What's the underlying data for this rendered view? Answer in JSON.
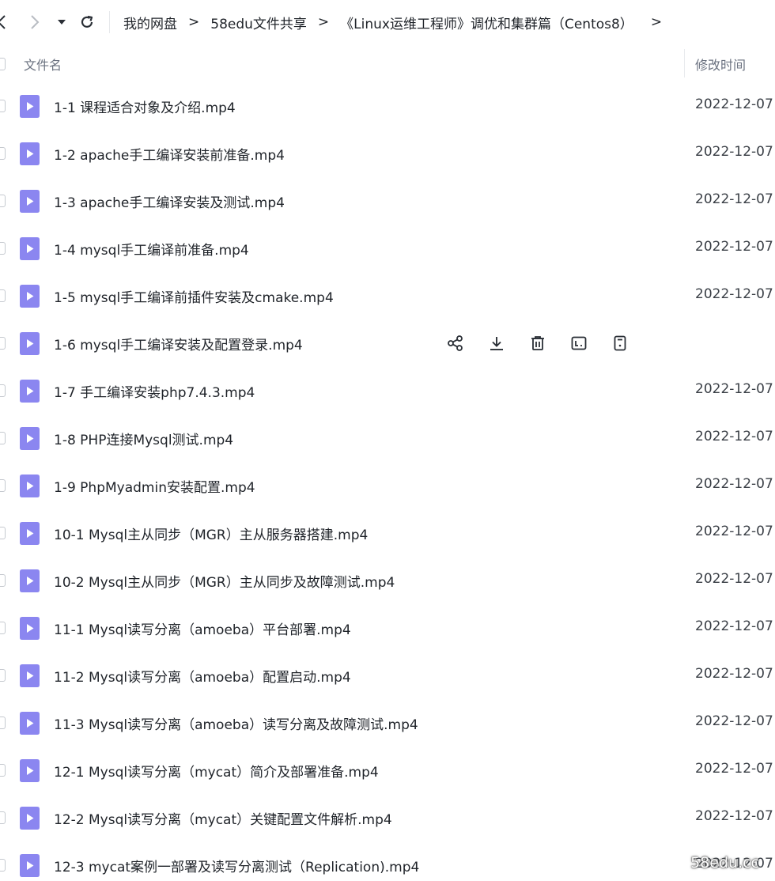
{
  "navigation": {
    "back_icon": "chevron-left-icon",
    "forward_icon": "chevron-right-icon",
    "dropdown_icon": "caret-down-icon",
    "refresh_icon": "refresh-icon"
  },
  "breadcrumb": {
    "items": [
      "我的网盘",
      "58edu文件共享",
      "《Linux运维工程师》调优和集群篇（Centos8）"
    ],
    "separator": ">"
  },
  "list_header": {
    "name_label": "文件名",
    "time_label": "修改时间"
  },
  "files": [
    {
      "name": "1-1 课程适合对象及介绍.mp4",
      "time": "2022-12-07"
    },
    {
      "name": "1-2 apache手工编译安装前准备.mp4",
      "time": "2022-12-07"
    },
    {
      "name": "1-3 apache手工编译安装及测试.mp4",
      "time": "2022-12-07"
    },
    {
      "name": "1-4 mysql手工编译前准备.mp4",
      "time": "2022-12-07"
    },
    {
      "name": "1-5 mysql手工编译前插件安装及cmake.mp4",
      "time": "2022-12-07"
    },
    {
      "name": "1-6 mysql手工编译安装及配置登录.mp4",
      "time": ""
    },
    {
      "name": "1-7 手工编译安装php7.4.3.mp4",
      "time": "2022-12-07"
    },
    {
      "name": "1-8 PHP连接Mysql测试.mp4",
      "time": "2022-12-07"
    },
    {
      "name": "1-9 PhpMyadmin安装配置.mp4",
      "time": "2022-12-07"
    },
    {
      "name": "10-1 Mysql主从同步（MGR）主从服务器搭建.mp4",
      "time": "2022-12-07"
    },
    {
      "name": "10-2 Mysql主从同步（MGR）主从同步及故障测试.mp4",
      "time": "2022-12-07"
    },
    {
      "name": "11-1 Mysql读写分离（amoeba）平台部署.mp4",
      "time": "2022-12-07"
    },
    {
      "name": "11-2 Mysql读写分离（amoeba）配置启动.mp4",
      "time": "2022-12-07"
    },
    {
      "name": "11-3 Mysql读写分离（amoeba）读写分离及故障测试.mp4",
      "time": "2022-12-07"
    },
    {
      "name": "12-1 Mysql读写分离（mycat）简介及部署准备.mp4",
      "time": "2022-12-07"
    },
    {
      "name": "12-2 Mysql读写分离（mycat）关键配置文件解析.mp4",
      "time": "2022-12-07"
    },
    {
      "name": "12-3 mycat案例一部署及读写分离测试（Replication).mp4",
      "time": "2022-12-07"
    }
  ],
  "hover_row_index": 5,
  "row_actions": [
    "share-icon",
    "download-icon",
    "delete-icon",
    "rename-icon",
    "more-info-icon"
  ],
  "watermark": "58edu.cc",
  "colors": {
    "file_icon": "#8b86f0",
    "text": "#1f2329",
    "muted": "#6b7280"
  }
}
